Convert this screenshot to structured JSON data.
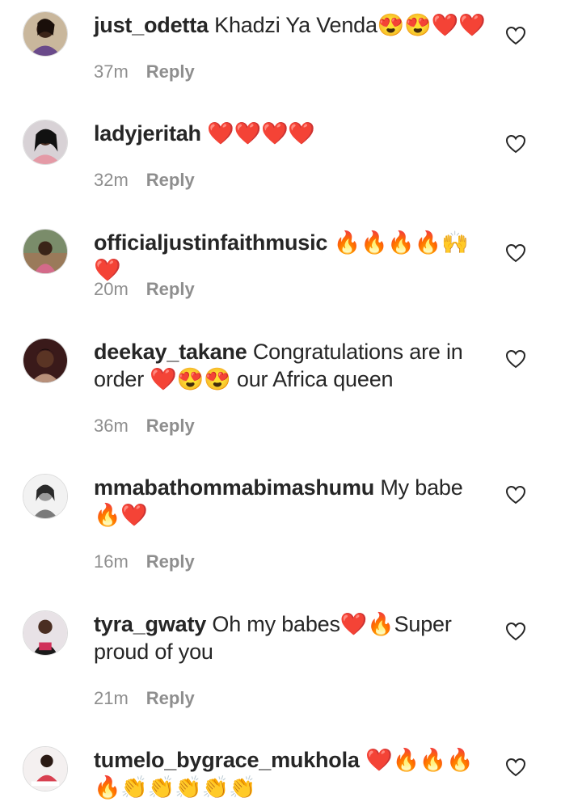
{
  "comments": [
    {
      "username": "just_odetta",
      "text": "Khadzi Ya Venda😍😍❤️❤️",
      "time": "37m",
      "reply": "Reply"
    },
    {
      "username": "ladyjeritah",
      "text": "❤️❤️❤️❤️",
      "time": "32m",
      "reply": "Reply"
    },
    {
      "username": "officialjustinfaithmusic",
      "text": "🔥🔥🔥🔥🙌❤️",
      "time": "20m",
      "reply": "Reply"
    },
    {
      "username": "deekay_takane",
      "text": "Congratulations are in order ❤️😍😍 our Africa queen",
      "time": "36m",
      "reply": "Reply"
    },
    {
      "username": "mmabathommabimashumu",
      "text": "My babe 🔥❤️",
      "time": "16m",
      "reply": "Reply"
    },
    {
      "username": "tyra_gwaty",
      "text": "Oh my babes❤️🔥Super proud of you",
      "time": "21m",
      "reply": "Reply"
    },
    {
      "username": "tumelo_bygrace_mukhola",
      "text": "❤️🔥🔥🔥🔥👏👏👏👏👏",
      "time": "",
      "reply": ""
    }
  ],
  "icons": {
    "like": "heart-outline-icon",
    "avatar": "profile-avatar"
  },
  "colors": {
    "text": "#262626",
    "meta": "#8e8e8e",
    "background": "#ffffff"
  }
}
